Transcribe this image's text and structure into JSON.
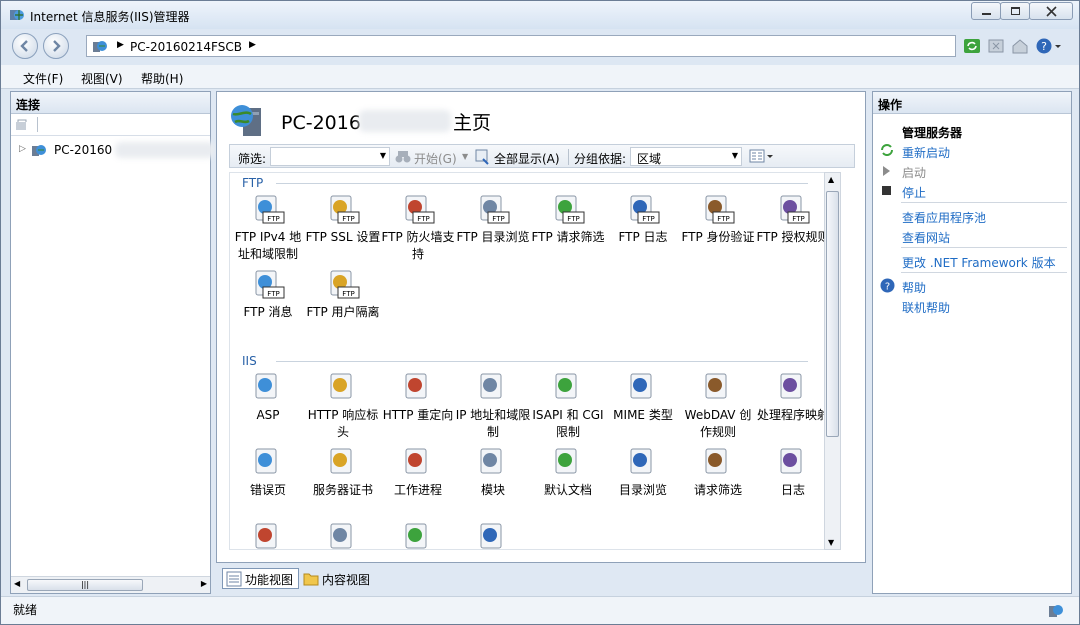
{
  "window": {
    "title": "Internet 信息服务(IIS)管理器"
  },
  "address": {
    "crumb": "PC-20160214FSCB"
  },
  "menu": [
    "文件(F)",
    "视图(V)",
    "帮助(H)"
  ],
  "left": {
    "header": "连接",
    "tree_node": "PC-20160"
  },
  "center": {
    "title_prefix": "PC-2016",
    "title_suffix": "主页",
    "filter_label": "筛选:",
    "start_label": "开始(G)",
    "showall_label": "全部显示(A)",
    "groupby_label": "分组依据:",
    "groupby_value": "区域",
    "groups": [
      {
        "name": "FTP",
        "items": [
          {
            "label": "FTP IPv4 地址和域限制",
            "icon": "ftp-ip-icon"
          },
          {
            "label": "FTP SSL 设置",
            "icon": "ftp-ssl-icon"
          },
          {
            "label": "FTP 防火墙支持",
            "icon": "ftp-firewall-icon"
          },
          {
            "label": "FTP 目录浏览",
            "icon": "ftp-dir-icon"
          },
          {
            "label": "FTP 请求筛选",
            "icon": "ftp-filter-icon"
          },
          {
            "label": "FTP 日志",
            "icon": "ftp-log-icon"
          },
          {
            "label": "FTP 身份验证",
            "icon": "ftp-auth-icon"
          },
          {
            "label": "FTP 授权规则",
            "icon": "ftp-authz-icon"
          },
          {
            "label": "FTP 消息",
            "icon": "ftp-message-icon"
          },
          {
            "label": "FTP 用户隔离",
            "icon": "ftp-isolation-icon"
          }
        ]
      },
      {
        "name": "IIS",
        "items": [
          {
            "label": "ASP",
            "icon": "asp-icon"
          },
          {
            "label": "HTTP 响应标头",
            "icon": "http-headers-icon"
          },
          {
            "label": "HTTP 重定向",
            "icon": "http-redirect-icon"
          },
          {
            "label": "IP 地址和域限制",
            "icon": "ip-restrict-icon"
          },
          {
            "label": "ISAPI 和 CGI 限制",
            "icon": "isapi-cgi-icon"
          },
          {
            "label": "MIME 类型",
            "icon": "mime-icon"
          },
          {
            "label": "WebDAV 创作规则",
            "icon": "webdav-icon"
          },
          {
            "label": "处理程序映射",
            "icon": "handler-icon"
          },
          {
            "label": "错误页",
            "icon": "error-page-icon"
          },
          {
            "label": "服务器证书",
            "icon": "cert-icon"
          },
          {
            "label": "工作进程",
            "icon": "worker-icon"
          },
          {
            "label": "模块",
            "icon": "modules-icon"
          },
          {
            "label": "默认文档",
            "icon": "default-doc-icon"
          },
          {
            "label": "目录浏览",
            "icon": "dir-browse-icon"
          },
          {
            "label": "请求筛选",
            "icon": "req-filter-icon"
          },
          {
            "label": "日志",
            "icon": "log-icon"
          }
        ]
      }
    ]
  },
  "tabs": {
    "features": "功能视图",
    "content": "内容视图"
  },
  "right": {
    "header": "操作",
    "manage": "管理服务器",
    "restart": "重新启动",
    "start": "启动",
    "stop": "停止",
    "view_pools": "查看应用程序池",
    "view_sites": "查看网站",
    "change_net": "更改 .NET Framework 版本",
    "help": "帮助",
    "online_help": "联机帮助"
  },
  "status": {
    "text": "就绪"
  },
  "colors": {
    "link": "#1f6cc5",
    "group": "#2a62a8"
  }
}
